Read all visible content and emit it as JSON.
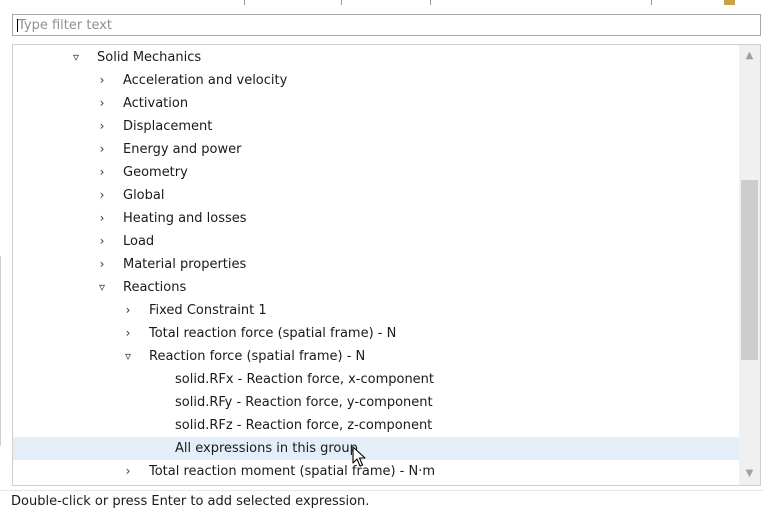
{
  "filter": {
    "value": "",
    "placeholder": "Type filter text"
  },
  "tree": {
    "items": [
      {
        "label": "Solid Mechanics",
        "level": 0,
        "expander": "expanded",
        "selected": false
      },
      {
        "label": "Acceleration and velocity",
        "level": 1,
        "expander": "collapsed",
        "selected": false
      },
      {
        "label": "Activation",
        "level": 1,
        "expander": "collapsed",
        "selected": false
      },
      {
        "label": "Displacement",
        "level": 1,
        "expander": "collapsed",
        "selected": false
      },
      {
        "label": "Energy and power",
        "level": 1,
        "expander": "collapsed",
        "selected": false
      },
      {
        "label": "Geometry",
        "level": 1,
        "expander": "collapsed",
        "selected": false
      },
      {
        "label": "Global",
        "level": 1,
        "expander": "collapsed",
        "selected": false
      },
      {
        "label": "Heating and losses",
        "level": 1,
        "expander": "collapsed",
        "selected": false
      },
      {
        "label": "Load",
        "level": 1,
        "expander": "collapsed",
        "selected": false
      },
      {
        "label": "Material properties",
        "level": 1,
        "expander": "collapsed",
        "selected": false
      },
      {
        "label": "Reactions",
        "level": 1,
        "expander": "expanded",
        "selected": false
      },
      {
        "label": "Fixed Constraint 1",
        "level": 2,
        "expander": "collapsed",
        "selected": false
      },
      {
        "label": "Total reaction force (spatial frame) - N",
        "level": 2,
        "expander": "collapsed",
        "selected": false
      },
      {
        "label": "Reaction force (spatial frame) - N",
        "level": 2,
        "expander": "expanded",
        "selected": false
      },
      {
        "label": "solid.RFx - Reaction force, x-component",
        "level": 3,
        "expander": "none",
        "selected": false
      },
      {
        "label": "solid.RFy - Reaction force, y-component",
        "level": 3,
        "expander": "none",
        "selected": false
      },
      {
        "label": "solid.RFz - Reaction force, z-component",
        "level": 3,
        "expander": "none",
        "selected": false
      },
      {
        "label": "All expressions in this group",
        "level": 3,
        "expander": "none",
        "selected": true
      },
      {
        "label": "Total reaction moment (spatial frame) - N·m",
        "level": 2,
        "expander": "collapsed",
        "selected": false
      }
    ]
  },
  "icons": {
    "collapsed": "chevron-right-icon",
    "expanded": "chevron-down-icon",
    "scroll_up": "scroll-up-arrow-icon",
    "scroll_down": "scroll-down-arrow-icon",
    "cursor": "mouse-pointer-icon"
  },
  "colors": {
    "selection": "#e3eef8",
    "scrollbar_track": "#f0f0f0",
    "scrollbar_thumb": "#cdcdcd"
  },
  "status": {
    "text": "Double-click or press Enter to add selected expression."
  }
}
